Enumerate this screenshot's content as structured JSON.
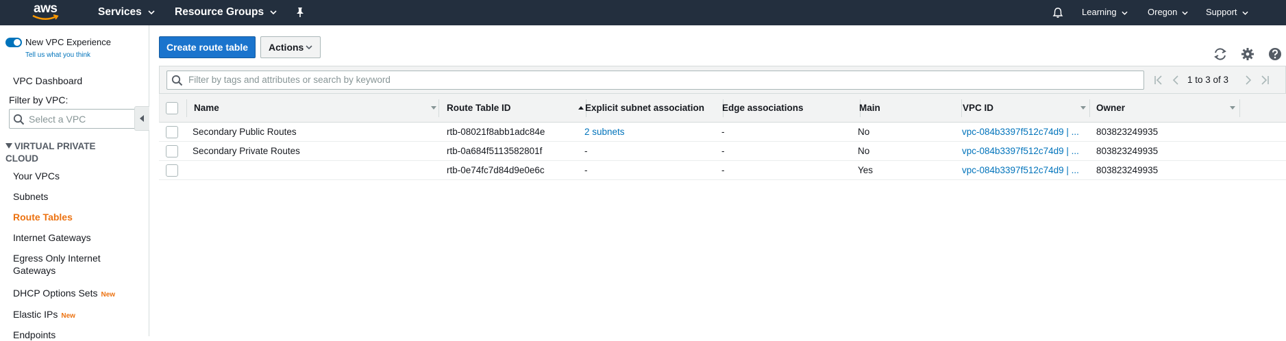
{
  "topnav": {
    "logo_text": "aws",
    "services": "Services",
    "resource_groups": "Resource Groups",
    "account": "Learning",
    "region": "Oregon",
    "support": "Support"
  },
  "sidebar": {
    "toggle_label": "New VPC Experience",
    "tell_us": "Tell us what you think",
    "dashboard": "VPC Dashboard",
    "filter_label": "Filter by VPC:",
    "filter_placeholder": "Select a VPC",
    "section_title": "VIRTUAL PRIVATE CLOUD",
    "items": [
      {
        "label": "Your VPCs",
        "badge": ""
      },
      {
        "label": "Subnets",
        "badge": ""
      },
      {
        "label": "Route Tables",
        "badge": "",
        "active": true
      },
      {
        "label": "Internet Gateways",
        "badge": ""
      },
      {
        "label": "Egress Only Internet Gateways",
        "badge": ""
      },
      {
        "label": "DHCP Options Sets",
        "badge": "New"
      },
      {
        "label": "Elastic IPs",
        "badge": "New"
      },
      {
        "label": "Endpoints",
        "badge": ""
      }
    ]
  },
  "toolbar": {
    "create_label": "Create route table",
    "actions_label": "Actions"
  },
  "filter": {
    "placeholder": "Filter by tags and attributes or search by keyword",
    "page_info": "1 to 3 of 3"
  },
  "table": {
    "columns": [
      "Name",
      "Route Table ID",
      "Explicit subnet association",
      "Edge associations",
      "Main",
      "VPC ID",
      "Owner"
    ],
    "rows": [
      {
        "name": "Secondary Public Routes",
        "route_table_id": "rtb-08021f8abb1adc84e",
        "explicit_subnet": "2 subnets",
        "edge": "-",
        "main": "No",
        "vpc_id": "vpc-084b3397f512c74d9 | ...",
        "owner": "803823249935"
      },
      {
        "name": "Secondary Private Routes",
        "route_table_id": "rtb-0a684f5113582801f",
        "explicit_subnet": "-",
        "edge": "-",
        "main": "No",
        "vpc_id": "vpc-084b3397f512c74d9 | ...",
        "owner": "803823249935"
      },
      {
        "name": "",
        "route_table_id": "rtb-0e74fc7d84d9e0e6c",
        "explicit_subnet": "-",
        "edge": "-",
        "main": "Yes",
        "vpc_id": "vpc-084b3397f512c74d9 | ...",
        "owner": "803823249935"
      }
    ]
  },
  "colors": {
    "nav_bg": "#232f3e",
    "primary": "#1a74cd",
    "link": "#0073bb",
    "active": "#ec7211"
  }
}
